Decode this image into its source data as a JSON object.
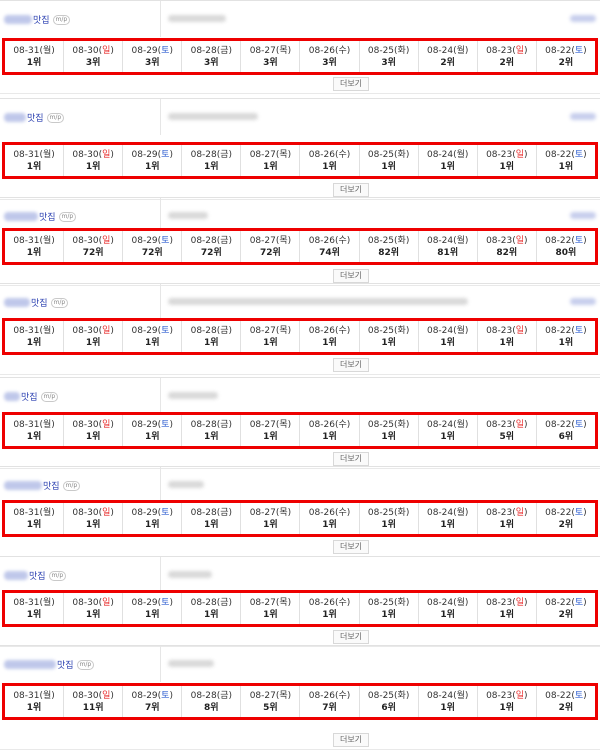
{
  "rank_suffix": "위",
  "more_label": "더보기",
  "pc_badge": "m/p",
  "colors": {
    "highlight_border": "#ee0000",
    "sunday": "#e83030",
    "saturday": "#2f5fd0",
    "keyword": "#2a3fb0"
  },
  "dates": [
    {
      "md": "08-31",
      "day": "월"
    },
    {
      "md": "08-30",
      "day": "일"
    },
    {
      "md": "08-29",
      "day": "토"
    },
    {
      "md": "08-28",
      "day": "금"
    },
    {
      "md": "08-27",
      "day": "목"
    },
    {
      "md": "08-26",
      "day": "수"
    },
    {
      "md": "08-25",
      "day": "화"
    },
    {
      "md": "08-24",
      "day": "월"
    },
    {
      "md": "08-23",
      "day": "일"
    },
    {
      "md": "08-22",
      "day": "토"
    }
  ],
  "keywords": [
    {
      "suffix": "맛집",
      "ranks": [
        "1위",
        "3위",
        "3위",
        "3위",
        "3위",
        "3위",
        "3위",
        "2위",
        "2위",
        "2위"
      ]
    },
    {
      "suffix": "맛집",
      "ranks": [
        "1위",
        "1위",
        "1위",
        "1위",
        "1위",
        "1위",
        "1위",
        "1위",
        "1위",
        "1위"
      ]
    },
    {
      "suffix": "맛집",
      "ranks": [
        "1위",
        "72위",
        "72위",
        "72위",
        "72위",
        "74위",
        "82위",
        "81위",
        "82위",
        "80위"
      ]
    },
    {
      "suffix": "맛집",
      "ranks": [
        "1위",
        "1위",
        "1위",
        "1위",
        "1위",
        "1위",
        "1위",
        "1위",
        "1위",
        "1위"
      ]
    },
    {
      "suffix": "맛집",
      "ranks": [
        "1위",
        "1위",
        "1위",
        "1위",
        "1위",
        "1위",
        "1위",
        "1위",
        "5위",
        "6위"
      ]
    },
    {
      "suffix": "맛집",
      "ranks": [
        "1위",
        "1위",
        "1위",
        "1위",
        "1위",
        "1위",
        "1위",
        "1위",
        "1위",
        "2위"
      ]
    },
    {
      "suffix": "맛집",
      "ranks": [
        "1위",
        "1위",
        "1위",
        "1위",
        "1위",
        "1위",
        "1위",
        "1위",
        "1위",
        "2위"
      ]
    },
    {
      "suffix": "맛집",
      "ranks": [
        "1위",
        "11위",
        "7위",
        "8위",
        "5위",
        "7위",
        "6위",
        "1위",
        "1위",
        "2위"
      ]
    }
  ]
}
